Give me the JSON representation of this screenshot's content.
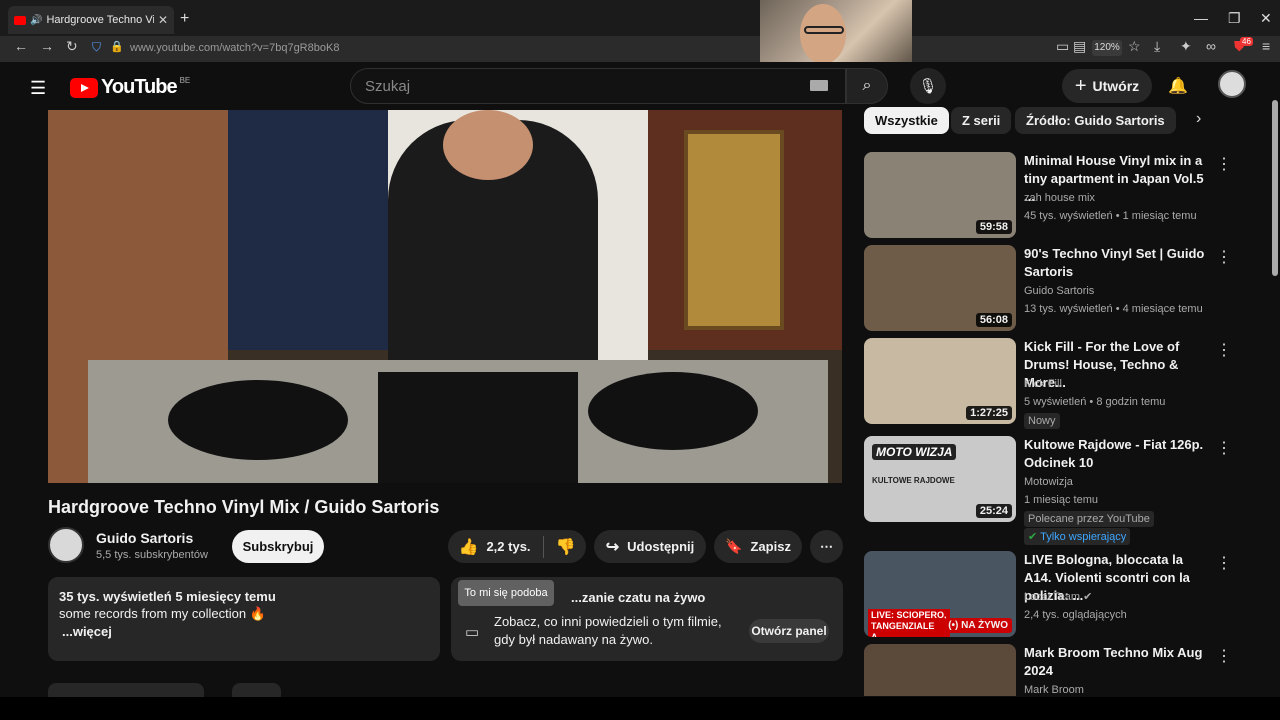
{
  "browser": {
    "tab_title": "Hardgroove Techno Vinyl M",
    "tab_close": "✕",
    "new_tab": "+",
    "url": "www.youtube.com/watch?v=7bq7gR8boK8",
    "zoom": "120%",
    "ext_badge": "46"
  },
  "header": {
    "logo_text": "YouTube",
    "country": "BE",
    "search_placeholder": "Szukaj",
    "create_label": "Utwórz"
  },
  "video": {
    "title": "Hardgroove Techno Vinyl Mix / Guido Sartoris",
    "channel_name": "Guido Sartoris",
    "channel_subs": "5,5 tys. subskrybentów",
    "subscribe_label": "Subskrybuj",
    "likes": "2,2 tys.",
    "share_label": "Udostępnij",
    "save_label": "Zapisz",
    "like_tooltip": "To mi się podoba"
  },
  "description": {
    "stats": "35 tys. wyświetleń  5 miesięcy temu",
    "text": "some records from my collection 🔥",
    "more_label": "...więcej"
  },
  "chat_replay": {
    "heading": "...zanie czatu na żywo",
    "body": "Zobacz, co inni powiedzieli o tym filmie, gdy był nadawany na żywo.",
    "open_label": "Otwórz panel"
  },
  "chips": [
    {
      "label": "Wszystkie",
      "active": true
    },
    {
      "label": "Z serii",
      "active": false
    },
    {
      "label": "Źródło: Guido Sartoris",
      "active": false
    }
  ],
  "recommendations": [
    {
      "title": "Minimal House Vinyl mix in a tiny apartment in Japan Vol.5 ...",
      "channel": "zah house mix",
      "meta": "45 tys. wyświetleń • 1 miesiąc temu",
      "duration": "59:58",
      "thumb_color": "#8a8275"
    },
    {
      "title": "90's Techno Vinyl Set | Guido Sartoris",
      "channel": "Guido Sartoris",
      "meta": "13 tys. wyświetleń • 4 miesiące temu",
      "duration": "56:08",
      "thumb_color": "#6e5c48"
    },
    {
      "title": "Kick Fill - For the Love of Drums! House, Techno & More...",
      "channel": "Kick Fill",
      "meta": "5 wyświetleń • 8 godzin temu",
      "duration": "1:27:25",
      "badge": "Nowy",
      "thumb_color": "#c8b9a2"
    },
    {
      "title": "Kultowe Rajdowe - Fiat 126p. Odcinek 10",
      "channel": "Motowizja",
      "meta": "1 miesiąc temu",
      "duration": "25:24",
      "badge": "Polecane przez YouTube",
      "members": "Tylko wspierający",
      "thumb_color": "#c9c9c9",
      "thumb_text": "MOTO WIZJA",
      "thumb_sub": "KULTOWE RAJDOWE"
    },
    {
      "title": "LIVE Bologna, bloccata la A14. Violenti scontri con la polizia: ...",
      "channel": "Local Team",
      "meta": "2,4 tys. oglądających",
      "live_label": "NA ŻYWO",
      "thumb_text": "LIVE: SCIOPERO, TANGENZIALE A...",
      "thumb_color": "#4a5562"
    },
    {
      "title": "Mark Broom Techno Mix Aug 2024",
      "channel": "Mark Broom",
      "thumb_color": "#5b4a3a"
    }
  ]
}
